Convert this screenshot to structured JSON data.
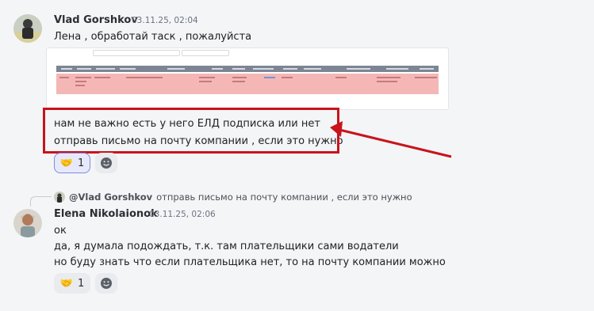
{
  "messages": [
    {
      "author": "Vlad Gorshkov",
      "time": "03.11.25, 02:04",
      "lines": [
        "Лена , обработай таск , пожалуйста",
        "нам не важно есть у него ЕЛД подписка или нет",
        "отправь письмо на почту компании , если это нужно"
      ],
      "reactions": [
        {
          "emoji": "🤝",
          "count": "1",
          "active": true
        }
      ]
    },
    {
      "reply_to": {
        "mention": "@Vlad Gorshkov",
        "text": "отправь письмо на почту компании , если это нужно"
      },
      "author": "Elena Nikolaionok",
      "time": "03.11.25, 02:06",
      "lines": [
        "ок",
        "да, я думала подождать, т.к. там плательщики сами водатели",
        "но буду знать что если плательщика нет, то на почту компании можно"
      ],
      "reactions": [
        {
          "emoji": "🤝",
          "count": "1",
          "active": false
        }
      ]
    }
  ],
  "icons": {
    "add_reaction": "smiley-icon"
  },
  "colors": {
    "highlight": "#c8141b",
    "active_reaction_border": "#7e8ae0"
  }
}
